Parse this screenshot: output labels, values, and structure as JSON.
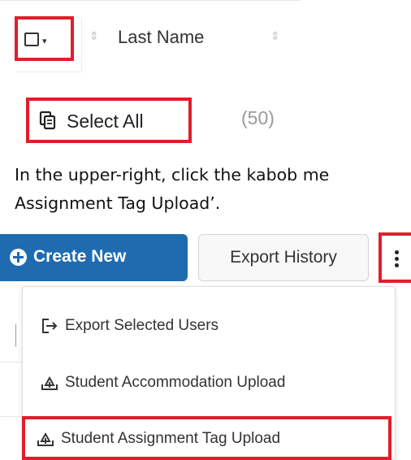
{
  "table_header": {
    "sort_column_label": "Last Name",
    "checkbox_caret": "▾"
  },
  "select_all": {
    "label": "Select All",
    "count": "(50)"
  },
  "instructions": {
    "line1": "In the upper-right, click the kabob me",
    "line2": "Assignment Tag Upload’."
  },
  "toolbar": {
    "create_label": "Create New",
    "export_history_label": "Export History"
  },
  "menu": {
    "items": [
      {
        "label": "Export Selected Users",
        "icon": "export-icon"
      },
      {
        "label": "Student Accommodation Upload",
        "icon": "upload-icon"
      },
      {
        "label": "Student Assignment Tag Upload",
        "icon": "upload-icon"
      }
    ]
  },
  "colors": {
    "highlight": "#e01e2b",
    "primary_button": "#1f6bb0"
  }
}
